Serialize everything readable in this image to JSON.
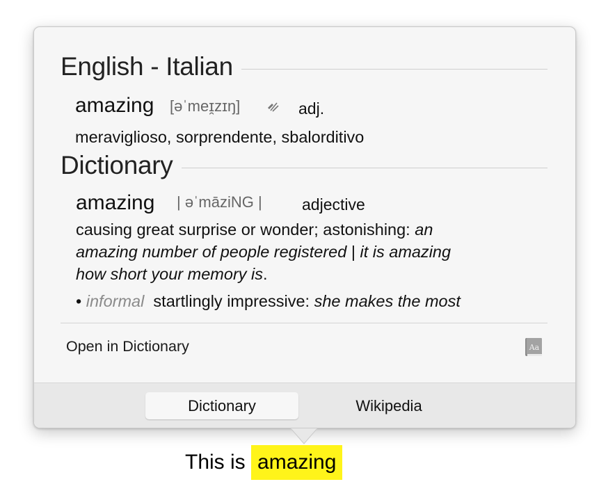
{
  "sections": {
    "bilingual": {
      "title": "English - Italian",
      "headword": "amazing",
      "pronunciation": "[əˈmeɪ̯zɪŋ]",
      "part_of_speech": "adj.",
      "translation": "meraviglioso, sorprendente, sbalorditivo"
    },
    "dictionary": {
      "title": "Dictionary",
      "headword": "amazing",
      "pronunciation": "| əˈmāziNG |",
      "part_of_speech": "adjective",
      "definition": "causing great surprise or wonder; astonishing:",
      "example_1a": "an",
      "example_1b": "amazing number of people registered",
      "example_sep": "|",
      "example_2a": "it is amazing",
      "example_2b": "how short your memory is",
      "period": ".",
      "bullet": "•",
      "register_label": "informal",
      "sense_2": "startlingly impressive:",
      "example_3": "she makes the most"
    }
  },
  "footer": {
    "open_label": "Open in Dictionary",
    "book_icon_text": "Aa"
  },
  "tabs": [
    {
      "label": "Dictionary",
      "active": true
    },
    {
      "label": "Wikipedia",
      "active": false
    }
  ],
  "selection": {
    "prefix": "This is ",
    "highlighted": "amazing",
    "highlight_color": "#fff41a"
  }
}
